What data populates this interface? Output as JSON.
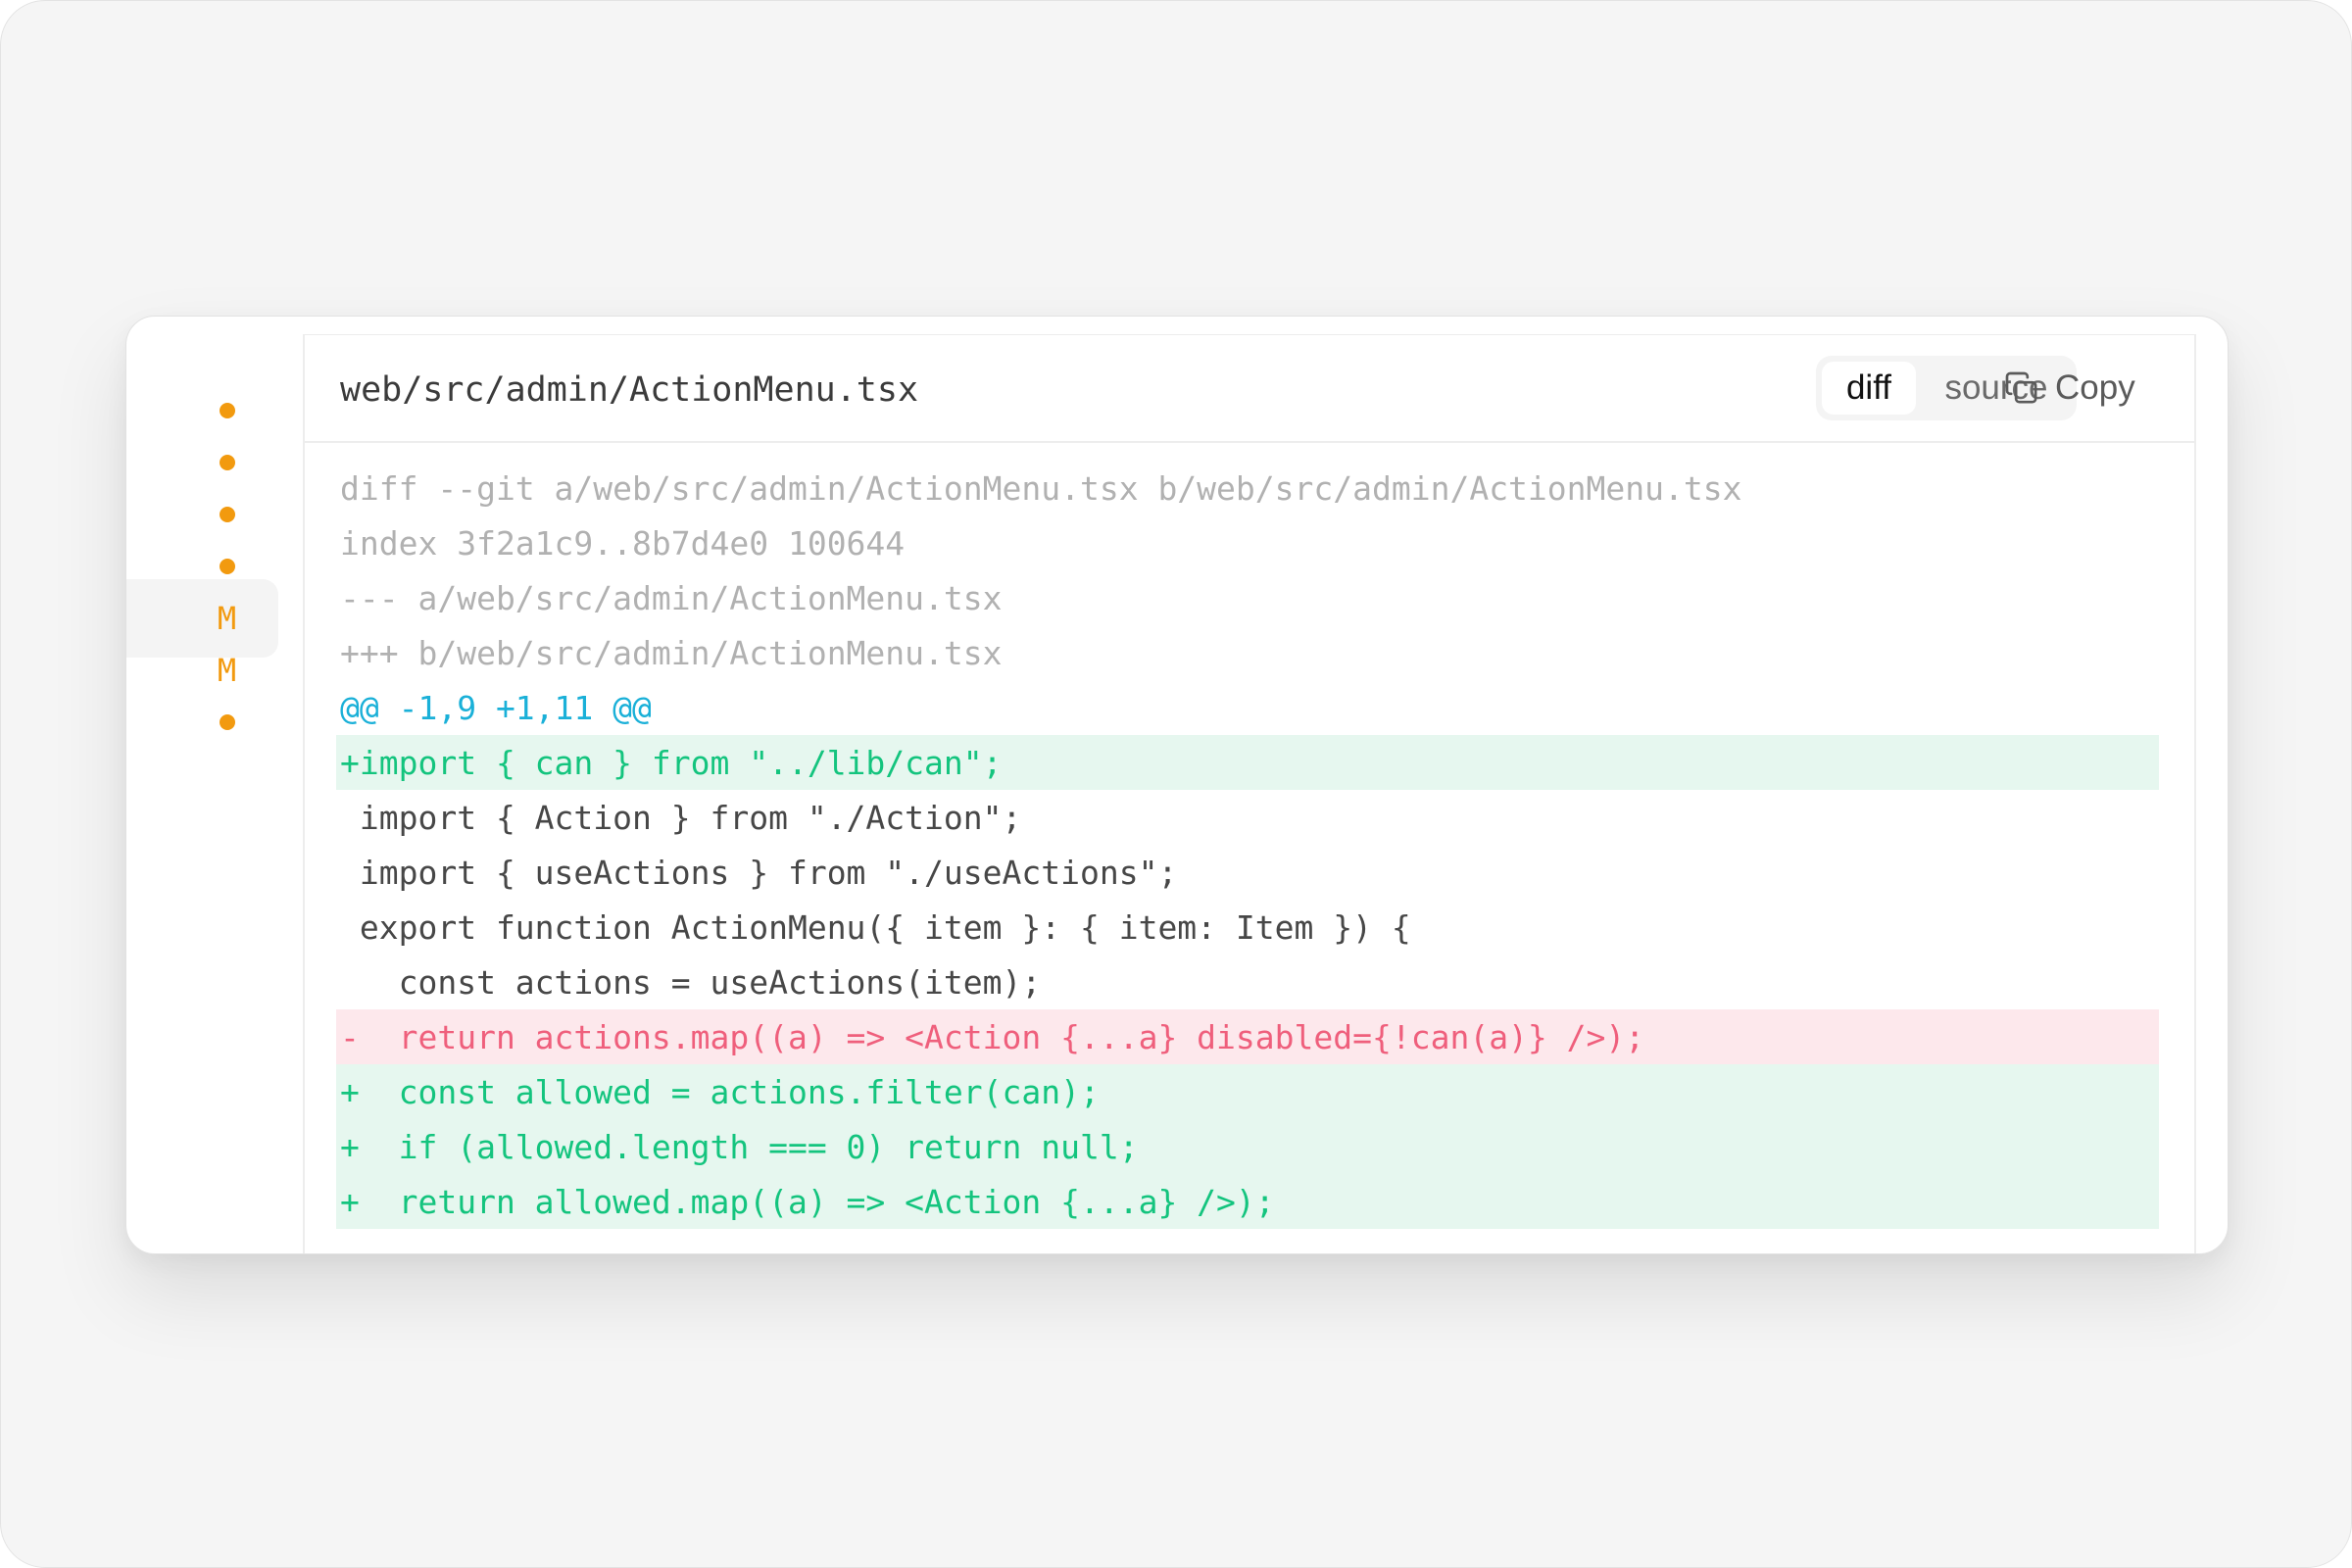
{
  "colors": {
    "status_orange": "#f29a0f",
    "added_text": "#14c47e",
    "added_bg": "#e6f7ef",
    "removed_text": "#ef5f7c",
    "removed_bg": "#fde8ec",
    "hunk_text": "#1ab0d8",
    "meta_text": "#b1b1b1"
  },
  "sidebar": {
    "items": [
      {
        "kind": "dot",
        "label": "",
        "active": false
      },
      {
        "kind": "dot",
        "label": "",
        "active": false
      },
      {
        "kind": "dot",
        "label": "",
        "active": false
      },
      {
        "kind": "dot",
        "label": "",
        "active": false
      },
      {
        "kind": "mark",
        "label": "M",
        "active": true
      },
      {
        "kind": "mark",
        "label": "M",
        "active": false
      },
      {
        "kind": "dot",
        "label": "",
        "active": false
      }
    ]
  },
  "file": {
    "path": "web/src/admin/ActionMenu.tsx"
  },
  "toolbar": {
    "diff_label": "diff",
    "source_label": "source",
    "selected_view": "diff",
    "copy_label": "Copy",
    "copy_icon": "copy-icon"
  },
  "diff": {
    "lines": [
      {
        "type": "meta",
        "text": "diff --git a/web/src/admin/ActionMenu.tsx b/web/src/admin/ActionMenu.tsx"
      },
      {
        "type": "meta",
        "text": "index 3f2a1c9..8b7d4e0 100644"
      },
      {
        "type": "meta",
        "text": "--- a/web/src/admin/ActionMenu.tsx"
      },
      {
        "type": "meta",
        "text": "+++ b/web/src/admin/ActionMenu.tsx"
      },
      {
        "type": "hunk",
        "text": "@@ -1,9 +1,11 @@"
      },
      {
        "type": "add",
        "text": "+import { can } from \"../lib/can\";"
      },
      {
        "type": "context",
        "text": " import { Action } from \"./Action\";"
      },
      {
        "type": "context",
        "text": " import { useActions } from \"./useActions\";"
      },
      {
        "type": "context",
        "text": " export function ActionMenu({ item }: { item: Item }) {"
      },
      {
        "type": "context",
        "text": "   const actions = useActions(item);"
      },
      {
        "type": "del",
        "text": "-  return actions.map((a) => <Action {...a} disabled={!can(a)} />);"
      },
      {
        "type": "add",
        "text": "+  const allowed = actions.filter(can);"
      },
      {
        "type": "add",
        "text": "+  if (allowed.length === 0) return null;"
      },
      {
        "type": "add",
        "text": "+  return allowed.map((a) => <Action {...a} />);"
      }
    ]
  }
}
